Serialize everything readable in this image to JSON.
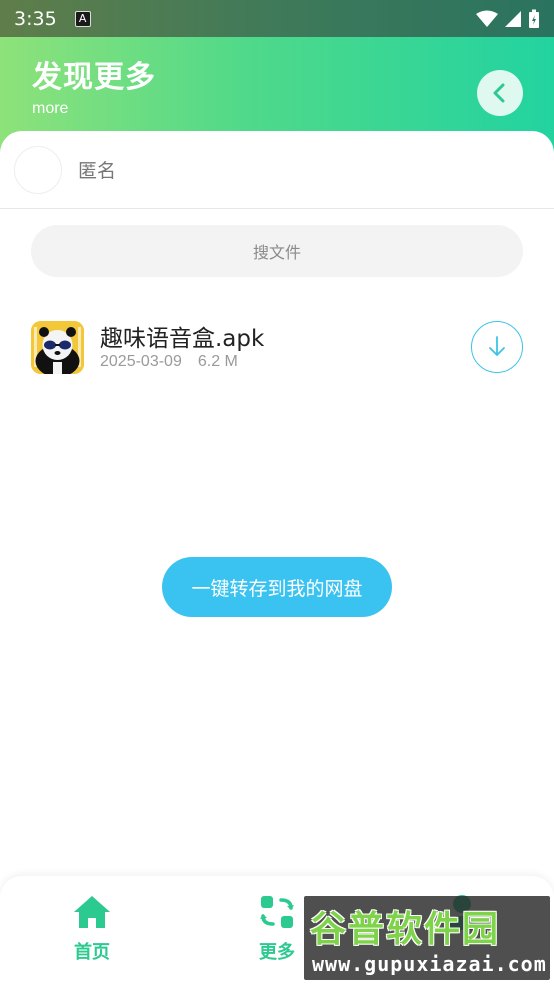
{
  "status_bar": {
    "time": "3:35",
    "badge": "A"
  },
  "header": {
    "title": "发现更多",
    "subtitle": "more"
  },
  "user": {
    "name": "匿名"
  },
  "search": {
    "placeholder": "搜文件"
  },
  "files": [
    {
      "name": "趣味语音盒.apk",
      "date": "2025-03-09",
      "size": "6.2 M"
    }
  ],
  "actions": {
    "save_label": "一键转存到我的网盘"
  },
  "bottom_nav": [
    {
      "label": "首页",
      "icon": "home-icon"
    },
    {
      "label": "更多",
      "icon": "refresh-icon"
    },
    {
      "label": "",
      "icon": "person-icon"
    }
  ],
  "watermark": {
    "brand": "谷普软件园",
    "url": "www.gupuxiazai.com"
  },
  "colors": {
    "accent_green": "#2cc990",
    "accent_blue": "#3ac3f0"
  }
}
